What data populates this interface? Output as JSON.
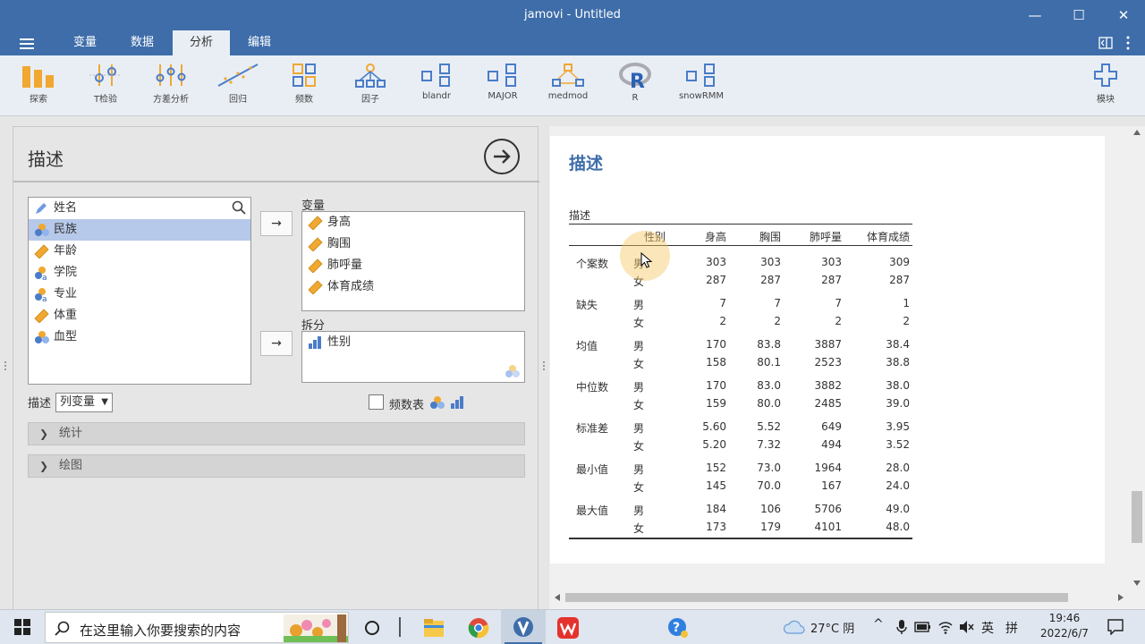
{
  "window": {
    "title": "jamovi - Untitled",
    "minimize": "—",
    "maximize": "☐",
    "close": "✕"
  },
  "tabs": [
    {
      "label": "变量"
    },
    {
      "label": "数据"
    },
    {
      "label": "分析"
    },
    {
      "label": "编辑"
    }
  ],
  "ribbon": [
    {
      "label": "探索",
      "icon": "exploration-icon"
    },
    {
      "label": "T检验",
      "icon": "ttest-icon"
    },
    {
      "label": "方差分析",
      "icon": "anova-icon"
    },
    {
      "label": "回归",
      "icon": "regression-icon"
    },
    {
      "label": "频数",
      "icon": "frequencies-icon"
    },
    {
      "label": "因子",
      "icon": "factor-icon"
    },
    {
      "label": "blandr",
      "icon": "module-icon"
    },
    {
      "label": "MAJOR",
      "icon": "module-icon"
    },
    {
      "label": "medmod",
      "icon": "medmod-icon"
    },
    {
      "label": "R",
      "icon": "r-icon"
    },
    {
      "label": "snowRMM",
      "icon": "module-icon"
    },
    {
      "label": "模块",
      "icon": "modules-plus-icon"
    }
  ],
  "panel": {
    "title": "描述",
    "variables": [
      {
        "name": "姓名",
        "type": "text",
        "selected": false
      },
      {
        "name": "民族",
        "type": "nominal",
        "selected": true
      },
      {
        "name": "年龄",
        "type": "continuous",
        "selected": false
      },
      {
        "name": "学院",
        "type": "nominal-text",
        "selected": false
      },
      {
        "name": "专业",
        "type": "nominal-text",
        "selected": false
      },
      {
        "name": "体重",
        "type": "continuous",
        "selected": false
      },
      {
        "name": "血型",
        "type": "nominal",
        "selected": false
      }
    ],
    "arrow_symbol": "→",
    "vars_label": "变量",
    "vars": [
      "身高",
      "胸围",
      "肺呼量",
      "体育成绩"
    ],
    "split_label": "拆分",
    "split": [
      "性别"
    ],
    "describe_label": "描述",
    "describe_select": "列变量",
    "freq_label": "频数表",
    "sections": [
      "统计",
      "绘图"
    ]
  },
  "results": {
    "title": "描述",
    "caption": "描述",
    "columns": [
      "性别",
      "身高",
      "胸围",
      "肺呼量",
      "体育成绩"
    ],
    "rows": [
      {
        "stat": "个案数",
        "values": [
          [
            "男",
            "303",
            "303",
            "303",
            "309"
          ],
          [
            "女",
            "287",
            "287",
            "287",
            "287"
          ]
        ]
      },
      {
        "stat": "缺失",
        "values": [
          [
            "男",
            "7",
            "7",
            "7",
            "1"
          ],
          [
            "女",
            "2",
            "2",
            "2",
            "2"
          ]
        ]
      },
      {
        "stat": "均值",
        "values": [
          [
            "男",
            "170",
            "83.8",
            "3887",
            "38.4"
          ],
          [
            "女",
            "158",
            "80.1",
            "2523",
            "38.8"
          ]
        ]
      },
      {
        "stat": "中位数",
        "values": [
          [
            "男",
            "170",
            "83.0",
            "3882",
            "38.0"
          ],
          [
            "女",
            "159",
            "80.0",
            "2485",
            "39.0"
          ]
        ]
      },
      {
        "stat": "标准差",
        "values": [
          [
            "男",
            "5.60",
            "5.52",
            "649",
            "3.95"
          ],
          [
            "女",
            "5.20",
            "7.32",
            "494",
            "3.52"
          ]
        ]
      },
      {
        "stat": "最小值",
        "values": [
          [
            "男",
            "152",
            "73.0",
            "1964",
            "28.0"
          ],
          [
            "女",
            "145",
            "70.0",
            "167",
            "24.0"
          ]
        ]
      },
      {
        "stat": "最大值",
        "values": [
          [
            "男",
            "184",
            "106",
            "5706",
            "49.0"
          ],
          [
            "女",
            "173",
            "179",
            "4101",
            "48.0"
          ]
        ]
      }
    ]
  },
  "taskbar": {
    "search_text": "在这里输入你要搜索的内容",
    "weather": "27°C 阴",
    "ime": "英",
    "ime2": "拼",
    "time": "19:46",
    "date": "2022/6/7"
  },
  "colors": {
    "accent": "#3e6da9",
    "selected": "#b7c9ea",
    "ribbon": "#e9eef5"
  }
}
